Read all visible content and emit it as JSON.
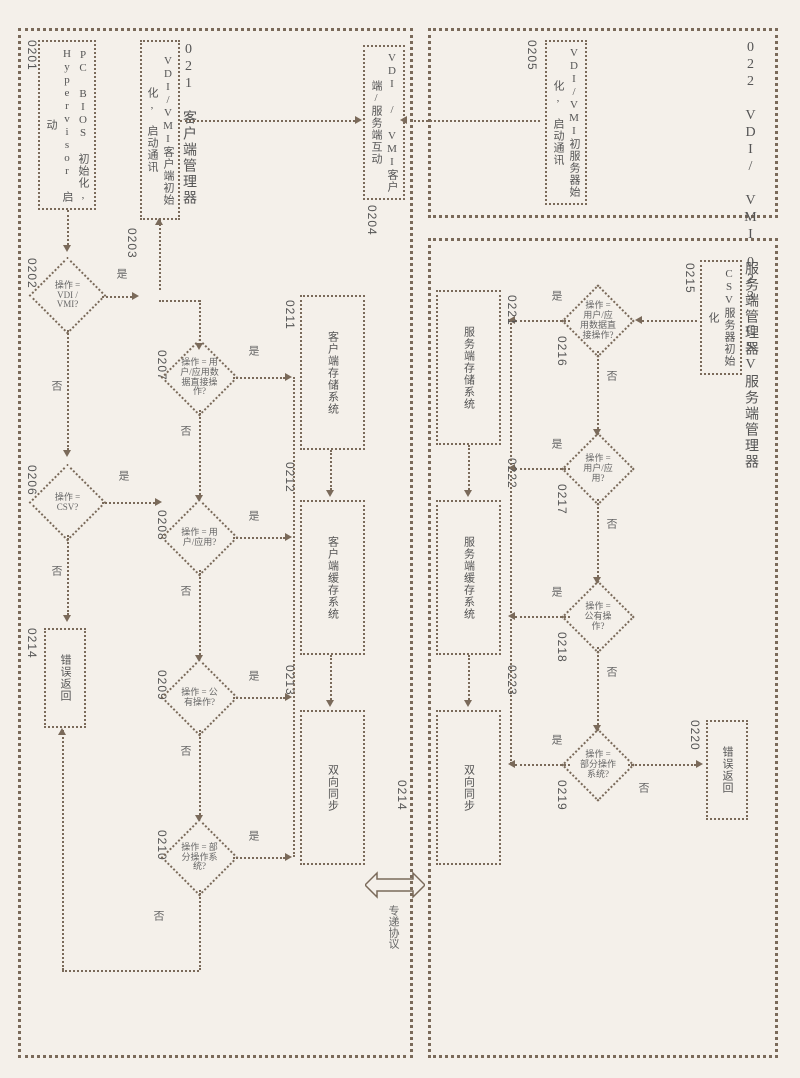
{
  "sections": {
    "client": "021 客户端管理器",
    "server": "022 VDI/ VMI 服务端管理器",
    "csv": "023 CSV服务端管理器"
  },
  "codes": {
    "c0201": "0201",
    "c0202": "0202",
    "c0203": "0203",
    "c0204": "0204",
    "c0205": "0205",
    "c0206": "0206",
    "c0207": "0207",
    "c0208": "0208",
    "c0209": "0209",
    "c0210": "0210",
    "c0211": "0211",
    "c0212": "0212",
    "c0213": "0213",
    "c0214": "0214",
    "c0215": "0215",
    "c0216": "0216",
    "c0217": "0217",
    "c0218": "0218",
    "c0219": "0219",
    "c0220": "0220",
    "c0221": "0221",
    "c0222": "0222",
    "c0223": "0223",
    "c0214b": "0214"
  },
  "boxes": {
    "b0201": "PC BIOS 初始化, Hypervisor 启动",
    "b0203": "VDI/VMI客户端初始化, 启动通讯",
    "b0204": "VDI / VMI客户端/服务端互动",
    "b0205": "VDI/VMI初服务器始化, 启动通讯",
    "b0214": "错误返回",
    "b0211": "客户端存储系统",
    "b0212": "客户端缓存系统",
    "b0213": "双向同步",
    "b0215": "CSV服务器初始化",
    "b0220": "错误返回",
    "b0221": "服务端存储系统",
    "b0222": "服务端缓存系统",
    "b0223": "双向同步",
    "protocol": "专递协议"
  },
  "diamonds": {
    "d0202": "操作 = VDI / VMI?",
    "d0206": "操作 = CSV?",
    "d0207": "操作 = 用户/应用数据直接操作?",
    "d0208": "操作 = 用户/应用?",
    "d0209": "操作 = 公有操作?",
    "d0210": "操作 = 部分操作系统?",
    "d0216": "操作 = 用户/应用数据直接操作?",
    "d0217": "操作 = 用户/应用?",
    "d0218": "操作 = 公有操作?",
    "d0219": "操作 = 部分操作系统?"
  },
  "labels": {
    "yes": "是",
    "no": "否"
  }
}
